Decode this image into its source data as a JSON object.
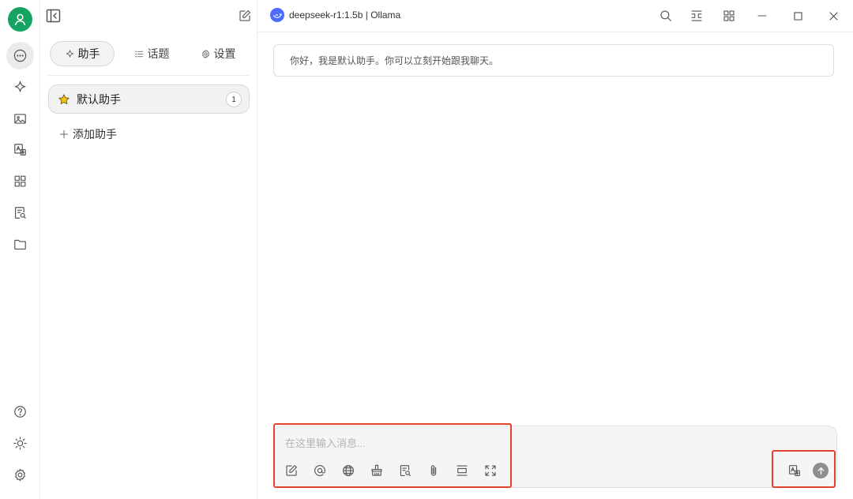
{
  "header": {
    "model_name": "deepseek-r1:1.5b",
    "separator": " | ",
    "provider": "Ollama"
  },
  "sidebar": {
    "tabs": [
      {
        "label": "助手",
        "icon": "sparkle-icon",
        "active": true
      },
      {
        "label": "话题",
        "icon": "list-icon",
        "active": false
      },
      {
        "label": "设置",
        "icon": "gear-icon",
        "active": false
      }
    ],
    "assistants": [
      {
        "label": "默认助手",
        "icon": "star-icon",
        "count": "1"
      }
    ],
    "add_label": "添加助手"
  },
  "chat": {
    "greeting": "你好，我是默认助手。你可以立刻开始跟我聊天。"
  },
  "input": {
    "placeholder": "在这里输入消息...",
    "value": ""
  },
  "colors": {
    "avatar": "#15a362",
    "model_logo": "#4d6bfe",
    "highlight": "#e2432e",
    "send_button": "#8e8e8e"
  }
}
